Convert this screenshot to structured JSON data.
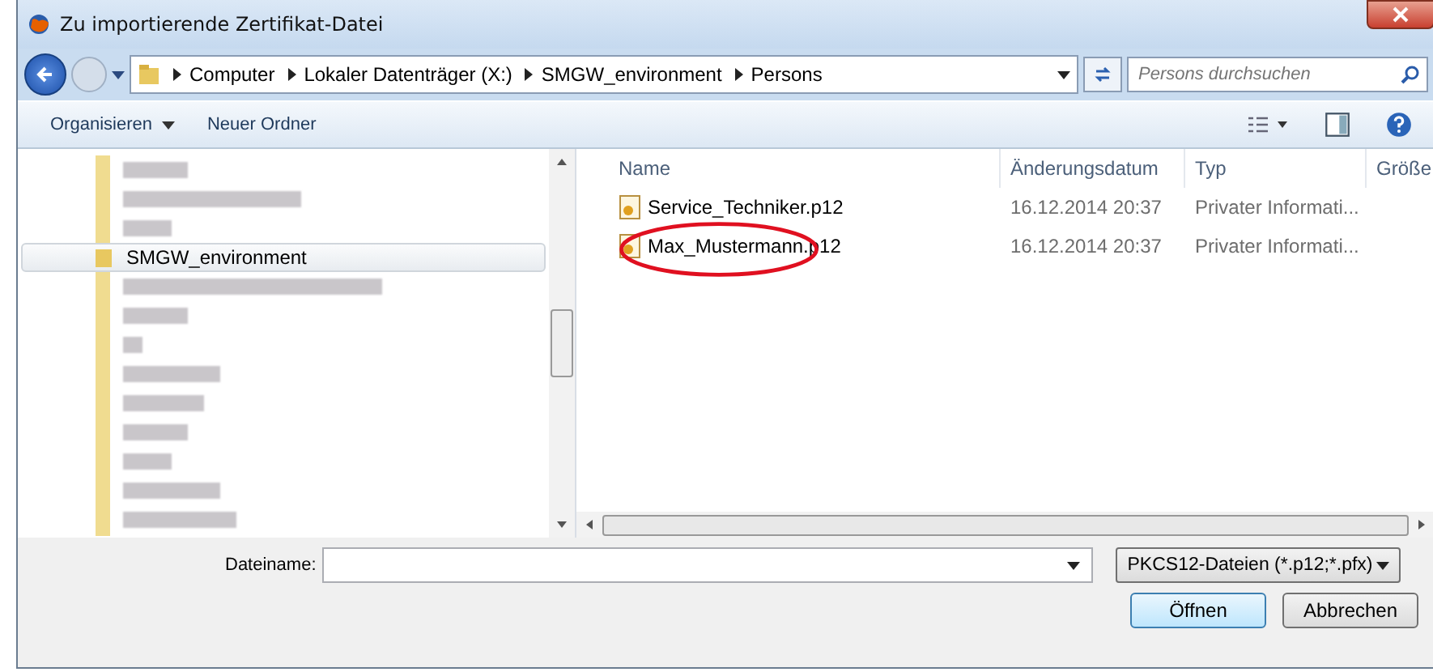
{
  "window": {
    "title": "Zu importierende Zertifikat-Datei"
  },
  "breadcrumb": [
    "Computer",
    "Lokaler Datenträger (X:)",
    "SMGW_environment",
    "Persons"
  ],
  "search": {
    "placeholder": "Persons durchsuchen"
  },
  "toolbar": [
    "Organisieren",
    "Neuer Ordner"
  ],
  "sidebar": {
    "items": [
      {
        "kind": "redacted",
        "selected": false
      },
      {
        "kind": "redacted",
        "selected": false
      },
      {
        "kind": "redacted",
        "selected": false
      },
      {
        "kind": "folder",
        "label": "SMGW_environment",
        "selected": true
      },
      {
        "kind": "redacted",
        "selected": false
      },
      {
        "kind": "redacted",
        "selected": false
      },
      {
        "kind": "redacted",
        "selected": false
      },
      {
        "kind": "redacted",
        "selected": false
      },
      {
        "kind": "redacted",
        "selected": false
      },
      {
        "kind": "redacted",
        "selected": false
      },
      {
        "kind": "redacted",
        "selected": false
      },
      {
        "kind": "redacted",
        "selected": false
      },
      {
        "kind": "redacted",
        "selected": false
      }
    ]
  },
  "table": {
    "columns": [
      "Name",
      "Änderungsdatum",
      "Typ",
      "Größe"
    ],
    "rows": [
      {
        "name": "Service_Techniker.p12",
        "date": "16.12.2014 20:37",
        "type": "Privater Informati...",
        "highlighted": false
      },
      {
        "name": "Max_Mustermann.p12",
        "date": "16.12.2014 20:37",
        "type": "Privater Informati...",
        "highlighted": true
      }
    ]
  },
  "filename": {
    "label": "Dateiname:"
  },
  "filter": "PKCS12-Dateien (*.p12;*.pfx)",
  "buttons": [
    "Öffnen",
    "Abbrechen"
  ]
}
